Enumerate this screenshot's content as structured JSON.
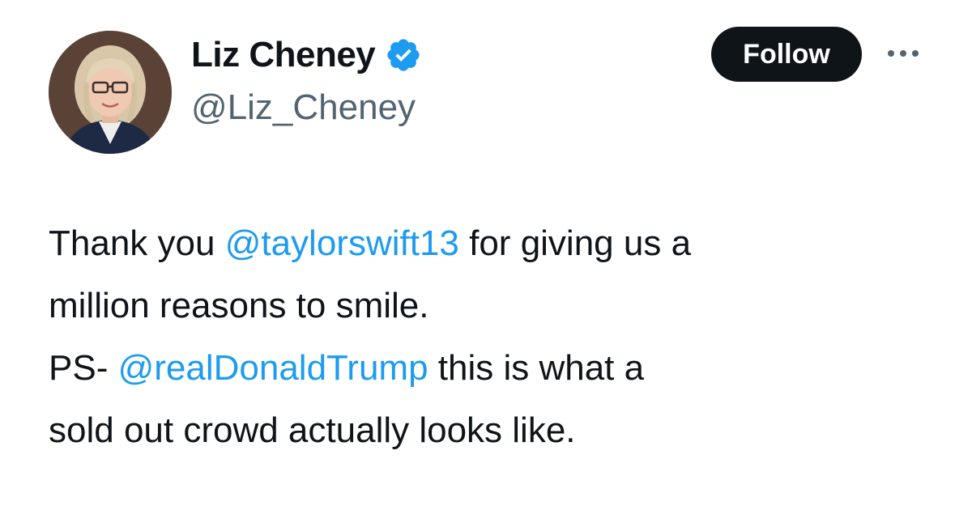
{
  "author": {
    "display_name": "Liz Cheney",
    "handle": "@Liz_Cheney",
    "verified": true,
    "verified_icon": "verified-badge-icon"
  },
  "actions": {
    "follow_label": "Follow",
    "more_icon": "more-options-icon"
  },
  "tweet": {
    "line1": {
      "before": "Thank you ",
      "mention": "@taylorswift13",
      "after": " for giving us a"
    },
    "line2": {
      "text": "million reasons to smile."
    },
    "line3": {
      "before": "PS- ",
      "mention": "@realDonaldTrump",
      "after": " this is what a"
    },
    "line4": {
      "text": "sold out crowd actually looks like."
    }
  },
  "colors": {
    "text": "#0f1419",
    "secondary": "#536471",
    "link": "#1d9bf0",
    "follow_bg": "#0f1419",
    "verified": "#1d9bf0"
  }
}
